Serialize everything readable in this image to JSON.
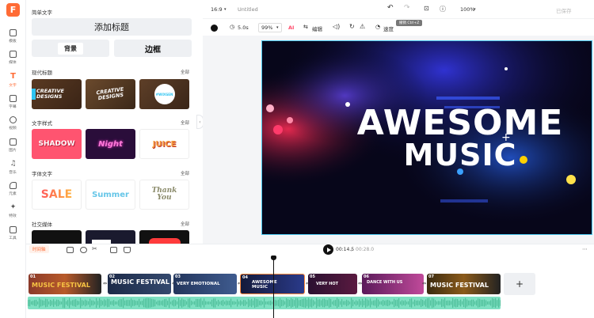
{
  "rail": {
    "logo": "F",
    "items": [
      {
        "label": "模板",
        "icon": "template-icon"
      },
      {
        "label": "媒体",
        "icon": "media-icon"
      },
      {
        "label": "文字",
        "icon": "text-icon",
        "active": true
      },
      {
        "label": "字幕",
        "icon": "subtitle-icon"
      },
      {
        "label": "视频",
        "icon": "video-icon"
      },
      {
        "label": "图片",
        "icon": "image-icon"
      },
      {
        "label": "音乐",
        "icon": "music-icon"
      },
      {
        "label": "元素",
        "icon": "elements-icon"
      },
      {
        "label": "特效",
        "icon": "effects-icon"
      },
      {
        "label": "工具",
        "icon": "tools-icon"
      }
    ]
  },
  "panel": {
    "simple_text_title": "简单文字",
    "add_title_button": "添加标题",
    "background_button": "背景",
    "border_button": "边框",
    "sections": [
      {
        "title": "现代标题",
        "all": "全部",
        "thumbs": [
          "CREATIVE DESIGNS",
          "CREATIVE DESIGNS",
          "#WIXGEN"
        ]
      },
      {
        "title": "文字样式",
        "all": "全部",
        "thumbs": [
          "SHADOW",
          "Night",
          "JUICE"
        ]
      },
      {
        "title": "字体文字",
        "all": "全部",
        "thumbs": [
          "SALE",
          "Summer",
          "Thank You"
        ]
      },
      {
        "title": "社交媒体",
        "all": "全部",
        "thumbs": [
          "",
          "",
          ""
        ]
      }
    ]
  },
  "topbar": {
    "aspect": "16:9",
    "project_name": "Untitled",
    "zoom": "100%",
    "saved_label": "已保存"
  },
  "toolbar": {
    "duration": "5.0s",
    "opacity": "99%",
    "ai_label": "AI",
    "edit_label": "编辑",
    "speed_label": "速度",
    "tooltip": "撤销 Ctrl+Z"
  },
  "video": {
    "line1": "AWESOME",
    "line2": "MUSIC"
  },
  "playbar": {
    "timeline_label": "时间轴",
    "current_time": "00:14.5",
    "total_time": "00:28.0"
  },
  "timeline": {
    "clips": [
      {
        "num": "01",
        "text": "MUSIC FESTIVAL"
      },
      {
        "num": "02",
        "text": "MUSIC FESTIVAL"
      },
      {
        "num": "03",
        "text": "VERY EMOTIONAL"
      },
      {
        "num": "04",
        "text": "AWESOME MUSIC"
      },
      {
        "num": "05",
        "text": "VERY HOT"
      },
      {
        "num": "06",
        "text": "DANCE WITH US"
      },
      {
        "num": "07",
        "text": "MUSIC FESTIVAL"
      }
    ],
    "add_label": "+"
  },
  "colors": {
    "accent": "#ff6b35",
    "selection": "#4cc9f0",
    "audio": "#7ee0c2"
  }
}
